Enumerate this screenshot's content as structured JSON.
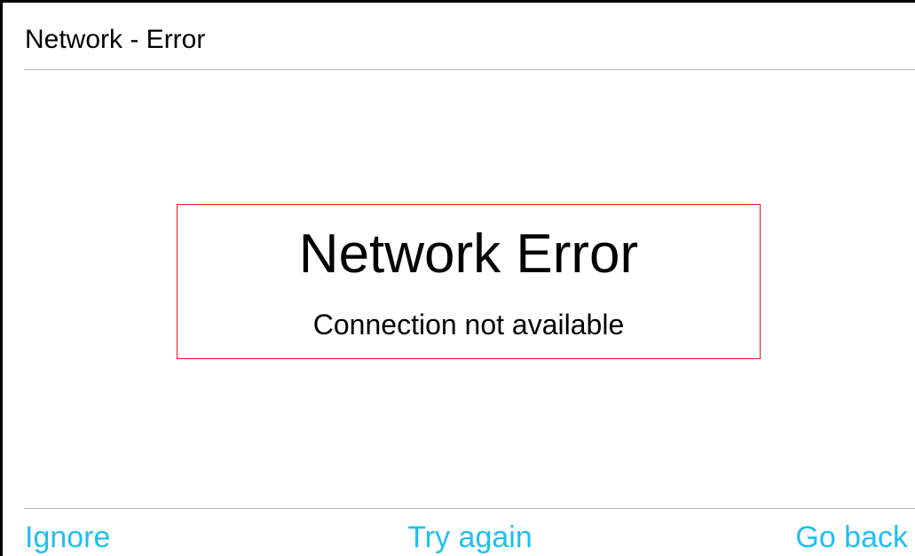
{
  "header": {
    "title": "Network - Error"
  },
  "dialog": {
    "title": "Network Error",
    "message": "Connection not available"
  },
  "footer": {
    "ignore_label": "Ignore",
    "try_again_label": "Try again",
    "go_back_label": "Go back"
  },
  "colors": {
    "accent": "#1ec0f0",
    "error_border": "#e01919",
    "divider": "#b5b5b5",
    "text": "#000000"
  }
}
